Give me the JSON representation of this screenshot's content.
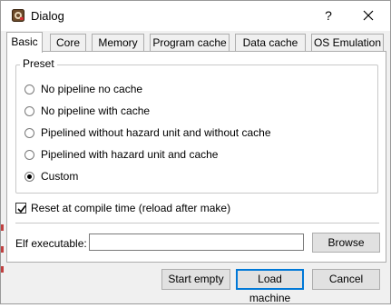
{
  "window": {
    "title": "Dialog",
    "help_label": "?",
    "icons": {
      "app": "app-icon",
      "close": "close-icon"
    }
  },
  "tabs": [
    {
      "label": "Basic",
      "active": true
    },
    {
      "label": "Core",
      "active": false
    },
    {
      "label": "Memory",
      "active": false
    },
    {
      "label": "Program cache",
      "active": false
    },
    {
      "label": "Data cache",
      "active": false
    },
    {
      "label": "OS Emulation",
      "active": false
    }
  ],
  "preset": {
    "title": "Preset",
    "options": [
      {
        "label": "No pipeline no cache",
        "checked": false
      },
      {
        "label": "No pipeline with cache",
        "checked": false
      },
      {
        "label": "Pipelined without hazard unit and without cache",
        "checked": false
      },
      {
        "label": "Pipelined with hazard unit and cache",
        "checked": false
      },
      {
        "label": "Custom",
        "checked": true
      }
    ]
  },
  "reset": {
    "label": "Reset at compile time (reload after make)",
    "checked": true
  },
  "elf": {
    "label": "Elf executable:",
    "value": "",
    "browse_label": "Browse"
  },
  "buttons": {
    "start_empty": "Start empty",
    "load_machine": "Load machine",
    "cancel": "Cancel"
  },
  "colors": {
    "focus": "#0078d7",
    "window_bg": "#f0f0f0",
    "panel_bg": "#ffffff"
  }
}
